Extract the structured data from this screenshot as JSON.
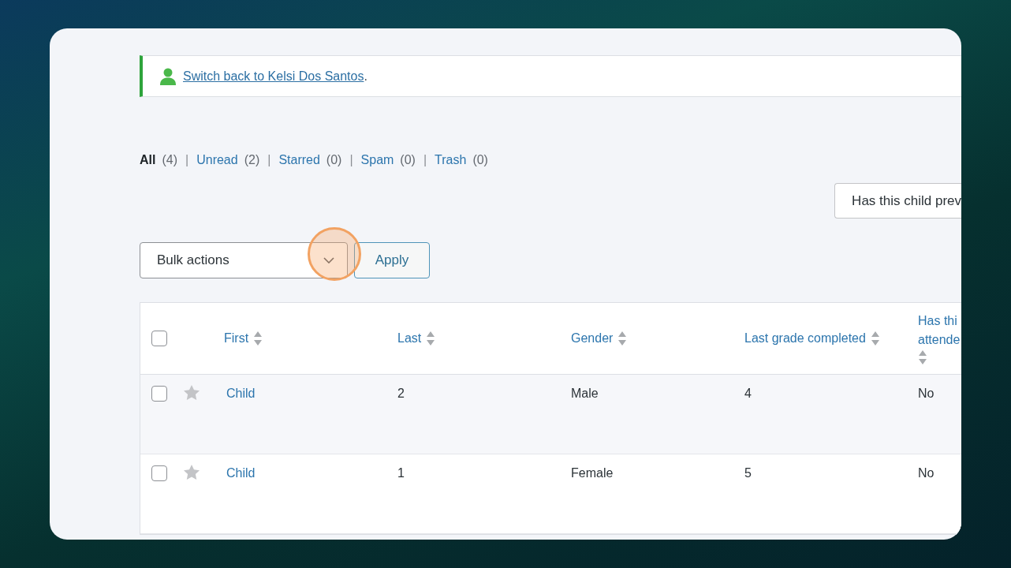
{
  "notice": {
    "link": "Switch back to Kelsi Dos Santos",
    "suffix": "."
  },
  "views": [
    {
      "label": "All",
      "count": "(4)",
      "selected": true
    },
    {
      "label": "Unread",
      "count": "(2)",
      "selected": false
    },
    {
      "label": "Starred",
      "count": "(0)",
      "selected": false
    },
    {
      "label": "Spam",
      "count": "(0)",
      "selected": false
    },
    {
      "label": "Trash",
      "count": "(0)",
      "selected": false
    }
  ],
  "separator": "|",
  "filter_select": {
    "value": "Has this child prev"
  },
  "bulk_actions": {
    "value": "Bulk actions"
  },
  "apply_button": "Apply",
  "table": {
    "select_all_checked": false,
    "columns": [
      {
        "lines": [
          "First"
        ],
        "sortable": true
      },
      {
        "lines": [
          "Last"
        ],
        "sortable": true
      },
      {
        "lines": [
          "Gender"
        ],
        "sortable": true
      },
      {
        "lines": [
          "Last grade completed"
        ],
        "sortable": true
      },
      {
        "lines": [
          "Has thi",
          "attende"
        ],
        "sortable": true
      }
    ],
    "rows": [
      {
        "checked": false,
        "starred": false,
        "cells": [
          "Child",
          "2",
          "Male",
          "4",
          "No"
        ]
      },
      {
        "checked": false,
        "starred": false,
        "cells": [
          "Child",
          "1",
          "Female",
          "5",
          "No"
        ]
      }
    ]
  }
}
